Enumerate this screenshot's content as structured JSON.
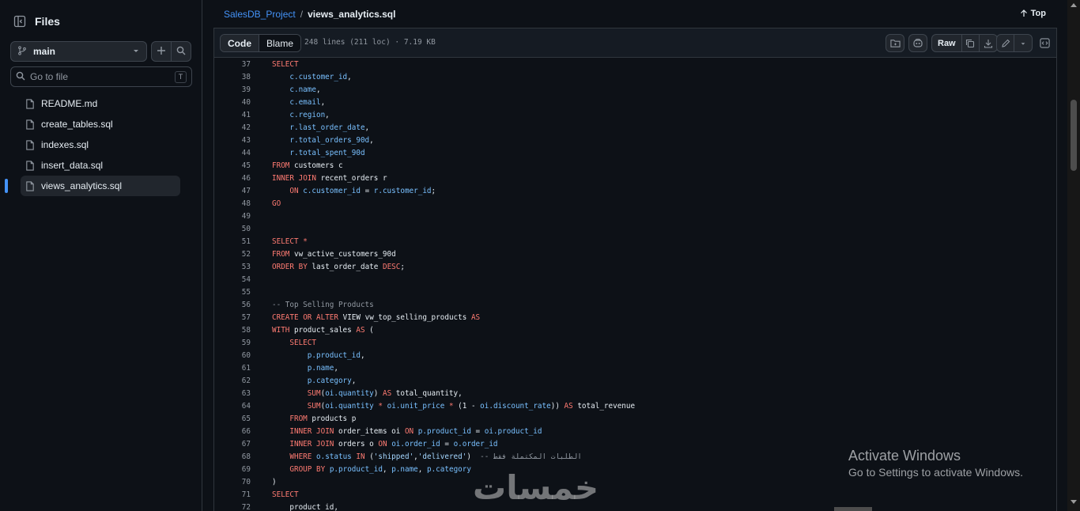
{
  "sidebar": {
    "title": "Files",
    "branch": "main",
    "search_placeholder": "Go to file",
    "search_shortcut": "T",
    "files": [
      {
        "label": "README.md"
      },
      {
        "label": "create_tables.sql"
      },
      {
        "label": "indexes.sql"
      },
      {
        "label": "insert_data.sql"
      },
      {
        "label": "views_analytics.sql",
        "active": true
      }
    ]
  },
  "header": {
    "repo": "SalesDB_Project",
    "separator": "/",
    "file": "views_analytics.sql",
    "top_label": "Top"
  },
  "toolbar": {
    "tabs": [
      "Code",
      "Blame"
    ],
    "file_meta": "248 lines (211 loc) · 7.19 KB",
    "raw_label": "Raw"
  },
  "code_lines": [
    {
      "n": "37",
      "text": "SELECT"
    },
    {
      "n": "38",
      "text": "    c.customer_id,"
    },
    {
      "n": "39",
      "text": "    c.name,"
    },
    {
      "n": "40",
      "text": "    c.email,"
    },
    {
      "n": "41",
      "text": "    c.region,"
    },
    {
      "n": "42",
      "text": "    r.last_order_date,"
    },
    {
      "n": "43",
      "text": "    r.total_orders_90d,"
    },
    {
      "n": "44",
      "text": "    r.total_spent_90d"
    },
    {
      "n": "45",
      "text": "FROM customers c"
    },
    {
      "n": "46",
      "text": "INNER JOIN recent_orders r"
    },
    {
      "n": "47",
      "text": "    ON c.customer_id = r.customer_id;"
    },
    {
      "n": "48",
      "text": "GO"
    },
    {
      "n": "49",
      "text": ""
    },
    {
      "n": "50",
      "text": ""
    },
    {
      "n": "51",
      "text": "SELECT *"
    },
    {
      "n": "52",
      "text": "FROM vw_active_customers_90d"
    },
    {
      "n": "53",
      "text": "ORDER BY last_order_date DESC;"
    },
    {
      "n": "54",
      "text": ""
    },
    {
      "n": "55",
      "text": ""
    },
    {
      "n": "56",
      "text": "-- Top Selling Products"
    },
    {
      "n": "57",
      "text": "CREATE OR ALTER VIEW vw_top_selling_products AS"
    },
    {
      "n": "58",
      "text": "WITH product_sales AS ("
    },
    {
      "n": "59",
      "text": "    SELECT"
    },
    {
      "n": "60",
      "text": "        p.product_id,"
    },
    {
      "n": "61",
      "text": "        p.name,"
    },
    {
      "n": "62",
      "text": "        p.category,"
    },
    {
      "n": "63",
      "text": "        SUM(oi.quantity) AS total_quantity,"
    },
    {
      "n": "64",
      "text": "        SUM(oi.quantity * oi.unit_price * (1 - oi.discount_rate)) AS total_revenue"
    },
    {
      "n": "65",
      "text": "    FROM products p"
    },
    {
      "n": "66",
      "text": "    INNER JOIN order_items oi ON p.product_id = oi.product_id"
    },
    {
      "n": "67",
      "text": "    INNER JOIN orders o ON oi.order_id = o.order_id"
    },
    {
      "n": "68",
      "text": "    WHERE o.status IN ('shipped','delivered')  -- الطلبات المكتملة فقط"
    },
    {
      "n": "69",
      "text": "    GROUP BY p.product_id, p.name, p.category"
    },
    {
      "n": "70",
      "text": ")"
    },
    {
      "n": "71",
      "text": "SELECT"
    },
    {
      "n": "72",
      "text": "    product_id,"
    }
  ],
  "watermark": {
    "activate_title": "Activate Windows",
    "activate_sub": "Go to Settings to activate Windows.",
    "logo_text": "خمسات"
  },
  "colors": {
    "background": "#0d1117",
    "keyword": "#ff7b72",
    "identifier": "#79c0ff",
    "link": "#4493f8",
    "muted": "#9198a1"
  }
}
